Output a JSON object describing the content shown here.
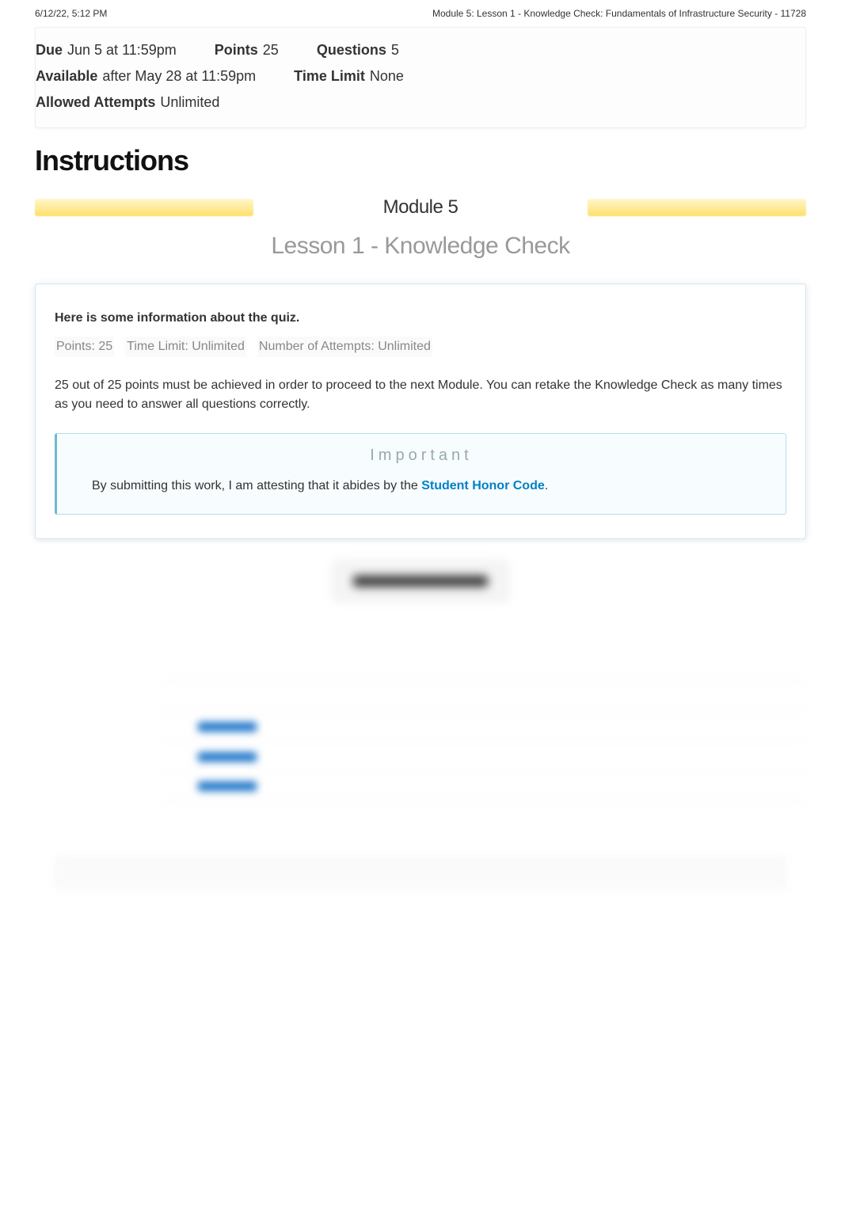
{
  "print_header": {
    "left": "6/12/22, 5:12 PM",
    "right": "Module 5: Lesson 1 - Knowledge Check: Fundamentals of Infrastructure Security - 11728"
  },
  "meta": {
    "due_label": "Due",
    "due_value": "Jun 5 at 11:59pm",
    "points_label": "Points",
    "points_value": "25",
    "questions_label": "Questions",
    "questions_value": "5",
    "available_label": "Available",
    "available_value": "after May 28 at 11:59pm",
    "timelimit_label": "Time Limit",
    "timelimit_value": "None",
    "attempts_label": "Allowed Attempts",
    "attempts_value": "Unlimited"
  },
  "instructions_heading": "Instructions",
  "module_title": "Module 5",
  "lesson_title": "Lesson 1 - Knowledge Check",
  "info": {
    "intro": "Here is some information about the quiz.",
    "pill_points": "Points: 25",
    "pill_timelimit": "Time Limit: Unlimited",
    "pill_attempts": "Number of Attempts: Unlimited",
    "requirement": "25 out of 25 points must be achieved in order to proceed to the next Module. You can retake the Knowledge Check as many times as you need to answer all questions correctly."
  },
  "important": {
    "title": "Important",
    "text_before": "By submitting this work, I am attesting that it abides by the ",
    "link_text": "Student Honor Code",
    "text_after": "."
  }
}
